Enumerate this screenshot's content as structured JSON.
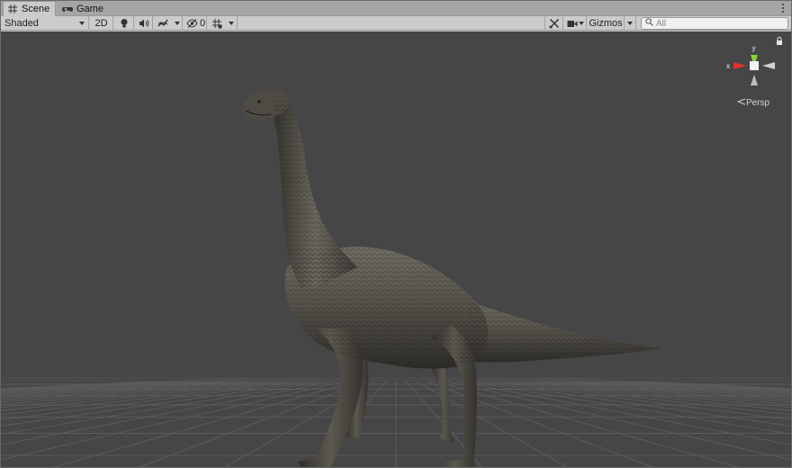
{
  "tabs": [
    {
      "label": "Scene",
      "icon": "grid-hash-icon",
      "active": true
    },
    {
      "label": "Game",
      "icon": "gamepad-icon",
      "active": false
    }
  ],
  "toolbar": {
    "shading_mode": "Shaded",
    "mode_2d": "2D",
    "hidden_count": "0",
    "gizmos_label": "Gizmos",
    "search_placeholder": "All"
  },
  "view": {
    "projection": "Persp",
    "axis_x": "x",
    "axis_y": "y"
  },
  "colors": {
    "viewport_bg": "#464646",
    "axis_x": "#e0312a",
    "axis_y": "#86d43a"
  }
}
